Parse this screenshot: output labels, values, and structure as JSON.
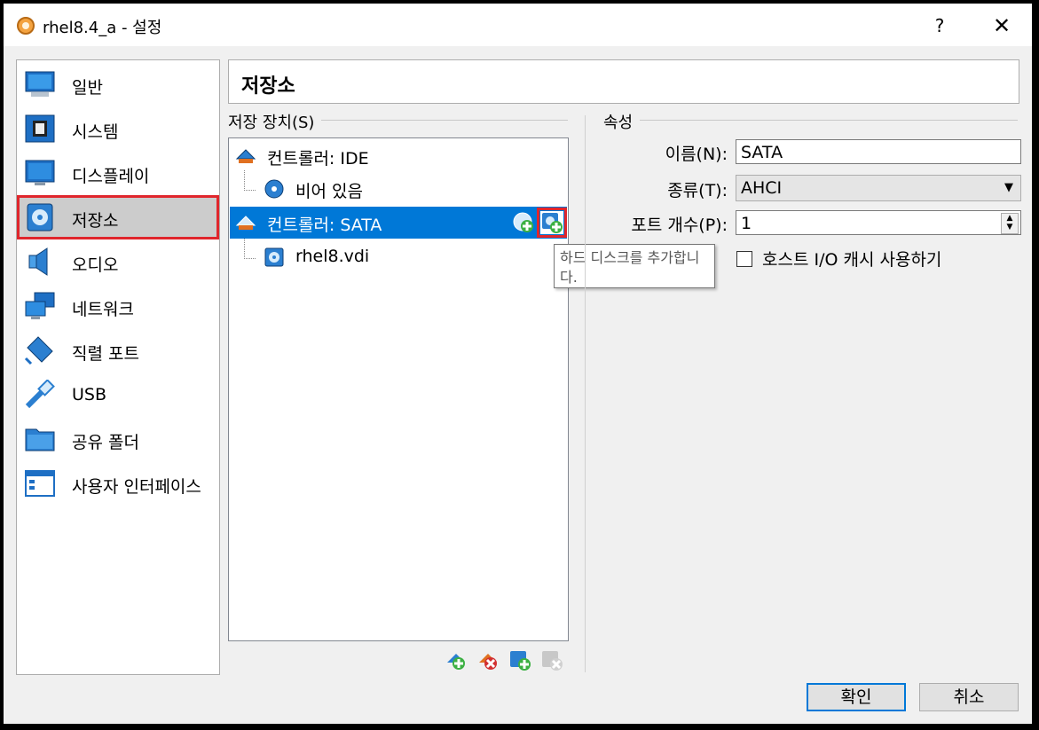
{
  "window": {
    "title": "rhel8.4_a - 설정",
    "help_label": "?",
    "close_label": "✕"
  },
  "sidebar": {
    "items": [
      {
        "label": "일반",
        "icon": "general-icon"
      },
      {
        "label": "시스템",
        "icon": "system-chip-icon"
      },
      {
        "label": "디스플레이",
        "icon": "display-monitor-icon"
      },
      {
        "label": "저장소",
        "icon": "storage-disk-icon",
        "selected": true
      },
      {
        "label": "오디오",
        "icon": "audio-speaker-icon"
      },
      {
        "label": "네트워크",
        "icon": "network-icon"
      },
      {
        "label": "직렬 포트",
        "icon": "serial-port-icon"
      },
      {
        "label": "USB",
        "icon": "usb-icon"
      },
      {
        "label": "공유 폴더",
        "icon": "shared-folder-icon"
      },
      {
        "label": "사용자 인터페이스",
        "icon": "user-interface-icon"
      }
    ]
  },
  "page": {
    "title": "저장소"
  },
  "storage": {
    "group_label": "저장 장치(S)",
    "tree": [
      {
        "label": "컨트롤러: IDE",
        "icon": "ide-controller-icon",
        "level": 0
      },
      {
        "label": "비어 있음",
        "icon": "optical-disc-icon",
        "level": 1
      },
      {
        "label": "컨트롤러: SATA",
        "icon": "sata-controller-icon",
        "level": 0,
        "selected": true
      },
      {
        "label": "rhel8.vdi",
        "icon": "hard-disk-icon",
        "level": 1
      }
    ],
    "tooltip": "하드 디스크를 추가합니다.",
    "tools": [
      "add-controller-icon",
      "remove-controller-icon",
      "add-attachment-icon",
      "remove-attachment-icon"
    ]
  },
  "attributes": {
    "group_label": "속성",
    "name_label": "이름(N):",
    "name_value": "SATA",
    "type_label": "종류(T):",
    "type_value": "AHCI",
    "port_label": "포트 개수(P):",
    "port_value": "1",
    "cache_label": "호스트 I/O 캐시 사용하기",
    "cache_checked": false
  },
  "buttons": {
    "ok": "확인",
    "cancel": "취소"
  },
  "colors": {
    "selection": "#0078d7",
    "highlight_box": "#e0262c"
  }
}
